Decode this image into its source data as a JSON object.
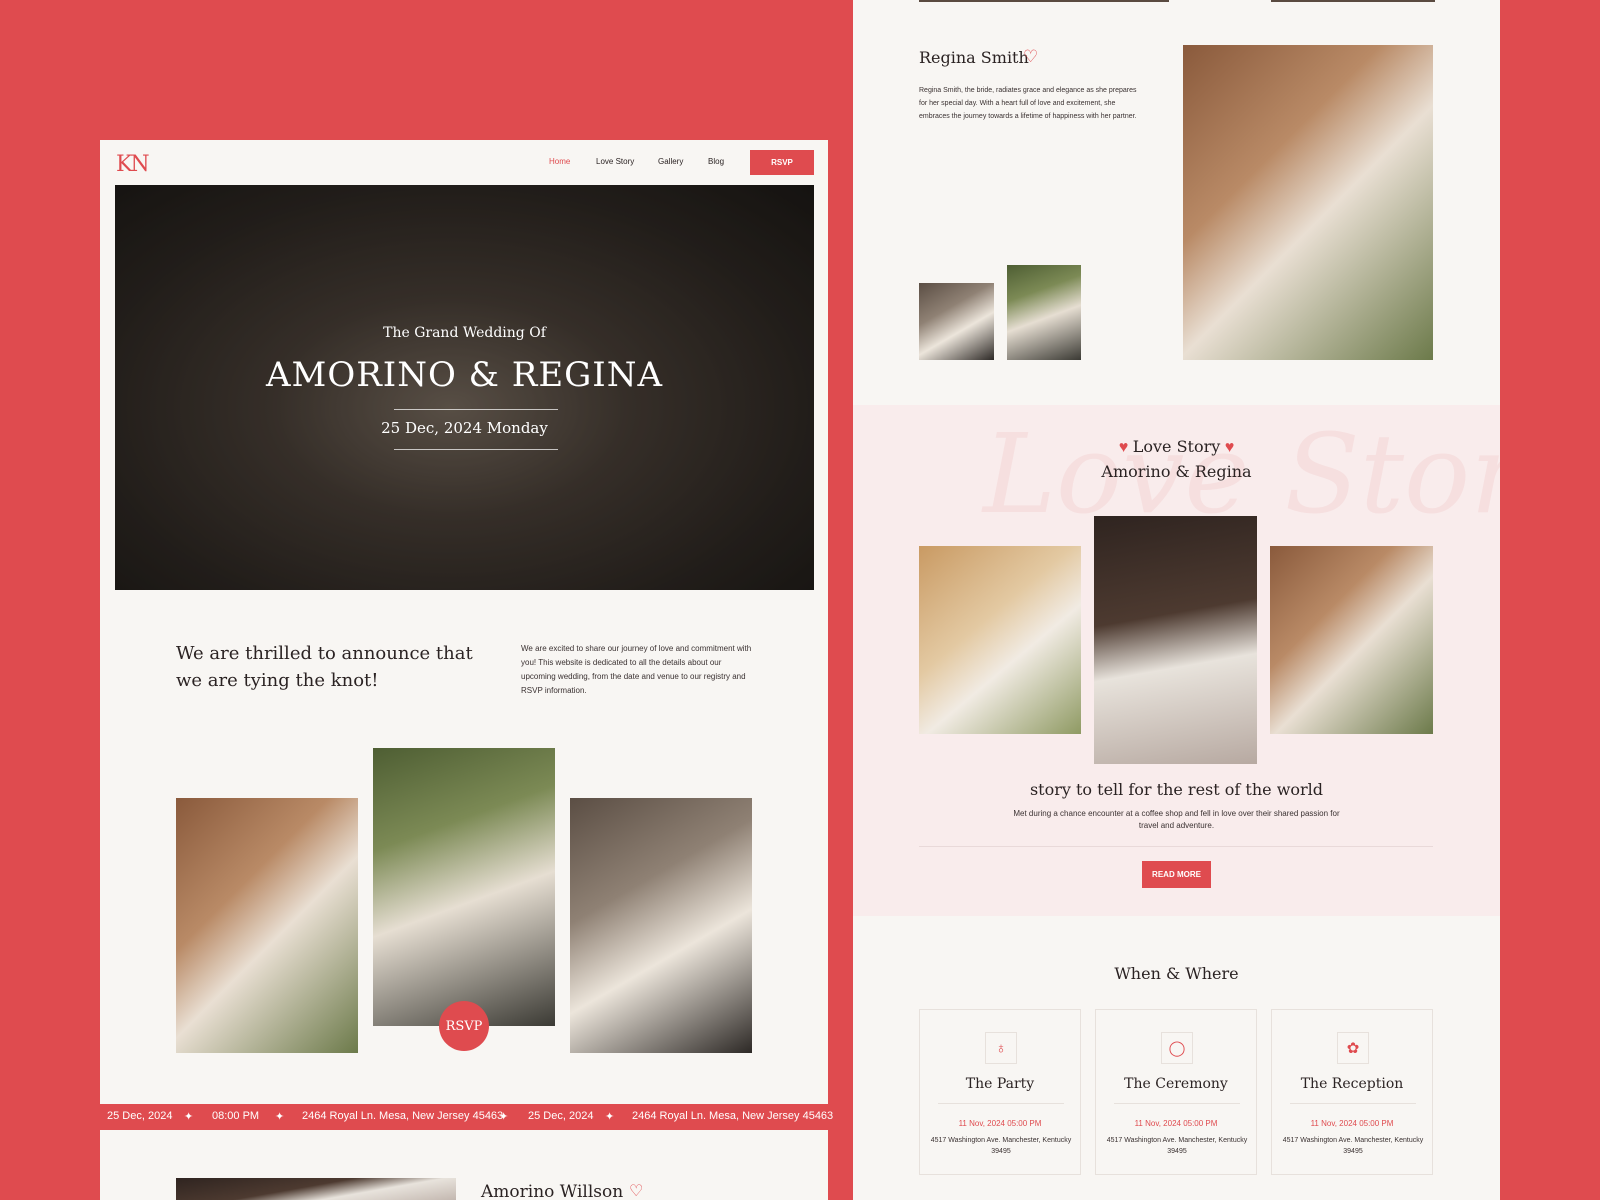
{
  "colors": {
    "accent": "#df4b4f",
    "page_bg": "#f8f6f3",
    "pink_band": "#f9ecec",
    "text": "#2b2323"
  },
  "header": {
    "logo": "KN",
    "nav": [
      "Home",
      "Love Story",
      "Gallery",
      "Blog"
    ],
    "rsvp_label": "RSVP"
  },
  "hero": {
    "eyebrow": "The Grand Wedding Of",
    "title": "AMORINO & REGINA",
    "date": "25 Dec, 2024 Monday"
  },
  "announce": {
    "heading": "We are thrilled to announce that we are tying the knot!",
    "body": "We are excited to share our journey of love and commitment with you! This website is dedicated to all the details about our upcoming wedding, from the date and venue to our registry and RSVP information.",
    "rsvp_circle": "RSVP"
  },
  "ticker": {
    "items": [
      "25 Dec, 2024",
      "08:00 PM",
      "2464 Royal Ln. Mesa, New Jersey 45463",
      "25 Dec, 2024",
      "2464 Royal Ln. Mesa, New Jersey 45463"
    ],
    "separator_icon": "sparkle-icon"
  },
  "groom": {
    "name": "Amorino Willson"
  },
  "bride": {
    "name": "Regina Smith",
    "bio": "Regina Smith, the bride, radiates grace and elegance as she prepares for her special day. With a heart full of love and excitement, she embraces the journey towards a lifetime of happiness with her partner."
  },
  "love_story": {
    "heading": "Love Story",
    "subheading": "Amorino & Regina",
    "ghost": "Love Story",
    "tagline": "story to tell for the rest of the world",
    "body": "Met during a chance encounter at a coffee shop and fell in love over their shared passion for travel and adventure.",
    "read_more": "READ MORE"
  },
  "when_where": {
    "heading": "When & Where",
    "cards": [
      {
        "icon": "wine-glass-icon",
        "title": "The Party",
        "date": "11 Nov, 2024 05:00 PM",
        "address": "4517 Washington Ave. Manchester, Kentucky 39495"
      },
      {
        "icon": "ring-icon",
        "title": "The Ceremony",
        "date": "11 Nov, 2024 05:00 PM",
        "address": "4517 Washington Ave. Manchester, Kentucky 39495"
      },
      {
        "icon": "flower-icon",
        "title": "The Reception",
        "date": "11 Nov, 2024 05:00 PM",
        "address": "4517 Washington Ave. Manchester, Kentucky 39495"
      }
    ]
  }
}
